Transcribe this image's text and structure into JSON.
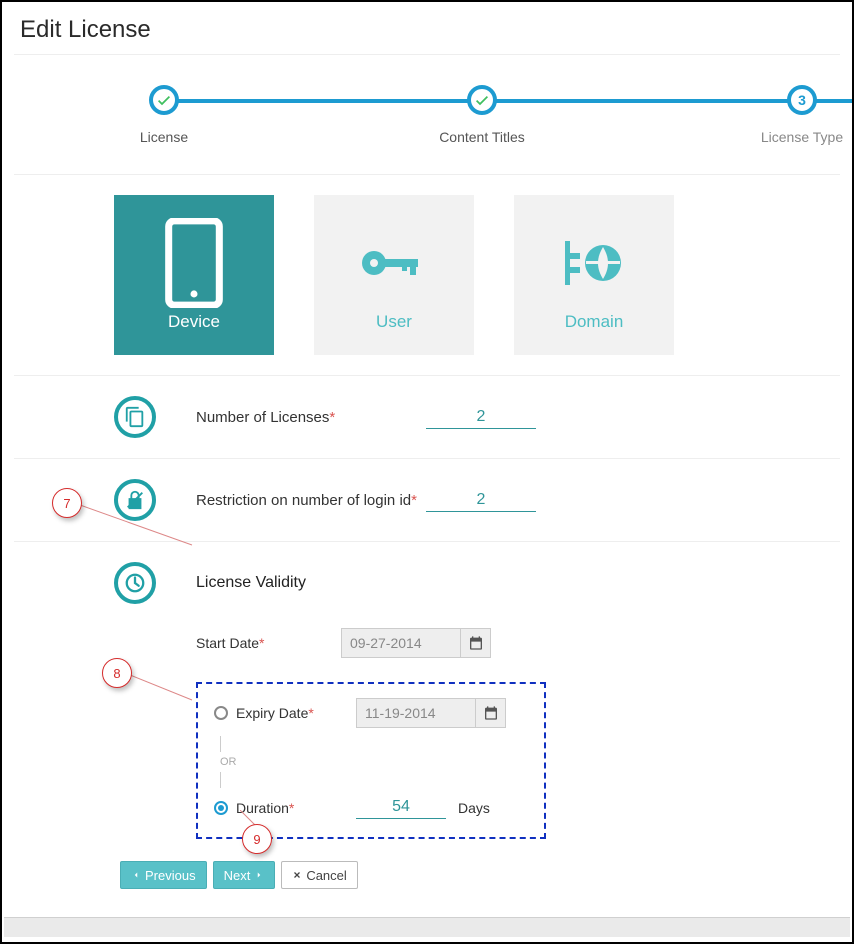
{
  "title": "Edit License",
  "stepper": {
    "steps": [
      {
        "label": "License",
        "state": "done"
      },
      {
        "label": "Content Titles",
        "state": "done"
      },
      {
        "label": "License Type",
        "state": "current",
        "num": "3"
      }
    ]
  },
  "license_types": {
    "device": "Device",
    "user": "User",
    "domain": "Domain"
  },
  "fields": {
    "num_licenses_label": "Number of Licenses",
    "num_licenses_value": "2",
    "login_restrict_label": "Restriction on number of login id",
    "login_restrict_value": "2"
  },
  "validity": {
    "section_label": "License Validity",
    "start_date_label": "Start Date",
    "start_date_value": "09-27-2014",
    "expiry_label": "Expiry Date",
    "expiry_value": "11-19-2014",
    "or_label": "OR",
    "duration_label": "Duration",
    "duration_value": "54",
    "duration_unit": "Days",
    "selected_option": "duration"
  },
  "buttons": {
    "previous": "Previous",
    "next": "Next",
    "cancel": "Cancel"
  },
  "annotations": {
    "a7": "7",
    "a8": "8",
    "a9": "9"
  }
}
